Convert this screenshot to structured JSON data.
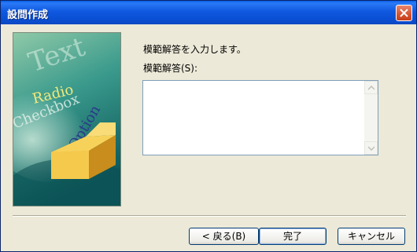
{
  "window": {
    "title": "設問作成",
    "close_icon": "close-icon"
  },
  "illustration": {
    "words": [
      "Text",
      "Radio",
      "Checkbox",
      "Option"
    ],
    "icon": "open-box-icon"
  },
  "content": {
    "description": "模範解答を入力します。",
    "answer_label": "模範解答(S):",
    "answer_value": ""
  },
  "buttons": {
    "back_label": "< 戻る(B)",
    "finish_label": "完了",
    "cancel_label": "キャンセル"
  },
  "colors": {
    "titlebar": "#0a52dd",
    "close": "#d5532f",
    "panel": "#ece9d8"
  }
}
